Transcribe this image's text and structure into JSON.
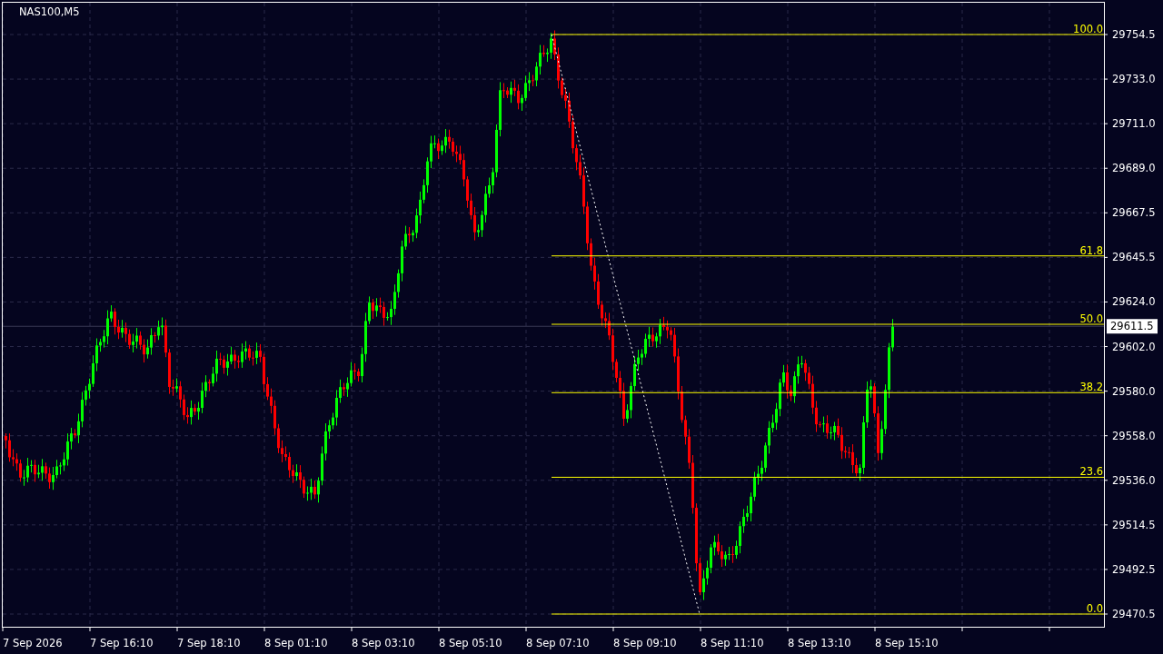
{
  "chart": {
    "title": "NAS100,M5",
    "price_axis": {
      "ticks": [
        "29754.5",
        "29733.0",
        "29711.0",
        "29689.0",
        "29667.5",
        "29645.5",
        "29624.0",
        "29602.0",
        "29580.0",
        "29558.0",
        "29536.0",
        "29514.5",
        "29492.5",
        "29470.5"
      ]
    },
    "time_axis": {
      "ticks": [
        "7 Sep 2026",
        "7 Sep 16:10",
        "7 Sep 18:10",
        "8 Sep 01:10",
        "8 Sep 03:10",
        "8 Sep 05:10",
        "8 Sep 07:10",
        "8 Sep 09:10",
        "8 Sep 11:10",
        "8 Sep 13:10",
        "8 Sep 15:10"
      ]
    },
    "current_price": "29611.5",
    "fibonacci": {
      "levels": [
        "100.0",
        "61.8",
        "50.0",
        "38.2",
        "23.6",
        "0.0"
      ]
    }
  }
}
